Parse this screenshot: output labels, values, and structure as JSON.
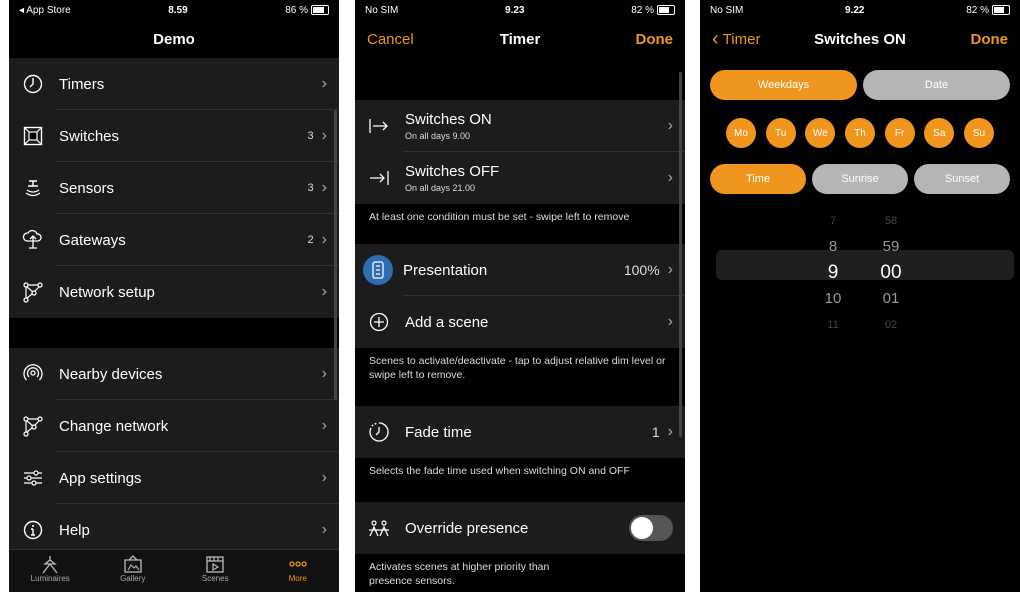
{
  "colors": {
    "accent": "#f0961e",
    "background": "#000000",
    "row": "#1c1c1e"
  },
  "panel1": {
    "status": {
      "left": "◂ App Store",
      "time": "8.59",
      "battery": "86 %"
    },
    "title": "Demo",
    "items_top": [
      {
        "label": "Timers",
        "value": "",
        "icon": "clock-icon"
      },
      {
        "label": "Switches",
        "value": "3",
        "icon": "switch-box-icon"
      },
      {
        "label": "Sensors",
        "value": "3",
        "icon": "sensor-icon"
      },
      {
        "label": "Gateways",
        "value": "2",
        "icon": "gateway-cloud-icon"
      },
      {
        "label": "Network setup",
        "value": "",
        "icon": "network-icon"
      }
    ],
    "items_bottom": [
      {
        "label": "Nearby devices",
        "icon": "nearby-icon"
      },
      {
        "label": "Change network",
        "icon": "network-icon"
      },
      {
        "label": "App settings",
        "icon": "sliders-icon"
      },
      {
        "label": "Help",
        "icon": "info-icon"
      }
    ],
    "tabs": [
      {
        "label": "Luminaires",
        "icon": "luminaire-icon"
      },
      {
        "label": "Gallery",
        "icon": "gallery-icon"
      },
      {
        "label": "Scenes",
        "icon": "scenes-icon"
      },
      {
        "label": "More",
        "icon": "more-icon"
      }
    ]
  },
  "panel2": {
    "status": {
      "left": "No SIM",
      "time": "9.23",
      "battery": "82 %"
    },
    "cancel": "Cancel",
    "title": "Timer",
    "done": "Done",
    "switches_on": {
      "label": "Switches ON",
      "sub": "On all days  9.00"
    },
    "switches_off": {
      "label": "Switches OFF",
      "sub": "On all days  21.00"
    },
    "note_condition": "At least one condition must be set - swipe left to remove",
    "presentation": {
      "label": "Presentation",
      "value": "100%"
    },
    "add_scene": "Add a scene",
    "note_scenes": "Scenes to activate/deactivate - tap to adjust relative dim level or swipe left to remove.",
    "fade": {
      "label": "Fade time",
      "value": "1"
    },
    "note_fade": "Selects the fade time used when switching ON and OFF",
    "override": {
      "label": "Override presence"
    },
    "note_override": "Activates scenes at higher priority than presence sensors."
  },
  "panel3": {
    "status": {
      "left": "No SIM",
      "time": "9.22",
      "battery": "82 %"
    },
    "back": "Timer",
    "title": "Switches ON",
    "done": "Done",
    "mode_tabs": [
      "Weekdays",
      "Date"
    ],
    "days": [
      "Mo",
      "Tu",
      "We",
      "Th",
      "Fr",
      "Sa",
      "Su"
    ],
    "time_tabs": [
      "Time",
      "Sunrise",
      "Sunset"
    ],
    "hours": [
      "7",
      "8",
      "9",
      "10",
      "11"
    ],
    "minutes": [
      "58",
      "59",
      "00",
      "01",
      "02"
    ]
  }
}
